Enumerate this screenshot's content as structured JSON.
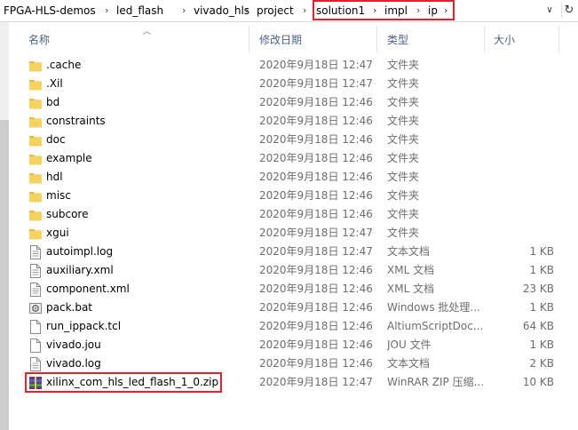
{
  "breadcrumb": [
    "FPGA-HLS-demos",
    "led_flash",
    "vivado_hls",
    "project",
    "solution1",
    "impl",
    "ip"
  ],
  "columns": {
    "name": "名称",
    "date": "修改日期",
    "type": "类型",
    "size": "大小"
  },
  "files": [
    {
      "name": ".cache",
      "date": "2020年9月18日 12:47",
      "type": "文件夹",
      "size": "",
      "icon": "folder-icon"
    },
    {
      "name": ".Xil",
      "date": "2020年9月18日 12:47",
      "type": "文件夹",
      "size": "",
      "icon": "folder-icon"
    },
    {
      "name": "bd",
      "date": "2020年9月18日 12:46",
      "type": "文件夹",
      "size": "",
      "icon": "folder-icon"
    },
    {
      "name": "constraints",
      "date": "2020年9月18日 12:46",
      "type": "文件夹",
      "size": "",
      "icon": "folder-icon"
    },
    {
      "name": "doc",
      "date": "2020年9月18日 12:46",
      "type": "文件夹",
      "size": "",
      "icon": "folder-icon"
    },
    {
      "name": "example",
      "date": "2020年9月18日 12:46",
      "type": "文件夹",
      "size": "",
      "icon": "folder-icon"
    },
    {
      "name": "hdl",
      "date": "2020年9月18日 12:46",
      "type": "文件夹",
      "size": "",
      "icon": "folder-icon"
    },
    {
      "name": "misc",
      "date": "2020年9月18日 12:46",
      "type": "文件夹",
      "size": "",
      "icon": "folder-icon"
    },
    {
      "name": "subcore",
      "date": "2020年9月18日 12:46",
      "type": "文件夹",
      "size": "",
      "icon": "folder-icon"
    },
    {
      "name": "xgui",
      "date": "2020年9月18日 12:47",
      "type": "文件夹",
      "size": "",
      "icon": "folder-icon"
    },
    {
      "name": "autoimpl.log",
      "date": "2020年9月18日 12:47",
      "type": "文本文档",
      "size": "1 KB",
      "icon": "text-file-icon"
    },
    {
      "name": "auxiliary.xml",
      "date": "2020年9月18日 12:46",
      "type": "XML 文档",
      "size": "1 KB",
      "icon": "text-file-icon"
    },
    {
      "name": "component.xml",
      "date": "2020年9月18日 12:46",
      "type": "XML 文档",
      "size": "23 KB",
      "icon": "text-file-icon"
    },
    {
      "name": "pack.bat",
      "date": "2020年9月18日 12:46",
      "type": "Windows 批处理...",
      "size": "1 KB",
      "icon": "batch-file-icon"
    },
    {
      "name": "run_ippack.tcl",
      "date": "2020年9月18日 12:46",
      "type": "AltiumScriptDoc...",
      "size": "64 KB",
      "icon": "blank-file-icon"
    },
    {
      "name": "vivado.jou",
      "date": "2020年9月18日 12:46",
      "type": "JOU 文件",
      "size": "1 KB",
      "icon": "blank-file-icon"
    },
    {
      "name": "vivado.log",
      "date": "2020年9月18日 12:46",
      "type": "文本文档",
      "size": "2 KB",
      "icon": "text-file-icon"
    },
    {
      "name": "xilinx_com_hls_led_flash_1_0.zip",
      "date": "2020年9月18日 12:47",
      "type": "WinRAR ZIP 压缩...",
      "size": "10 KB",
      "icon": "zip-file-icon"
    }
  ],
  "colors": {
    "folder": "#f7d25e",
    "highlight": "#e0222a",
    "header_text": "#4d6185"
  }
}
